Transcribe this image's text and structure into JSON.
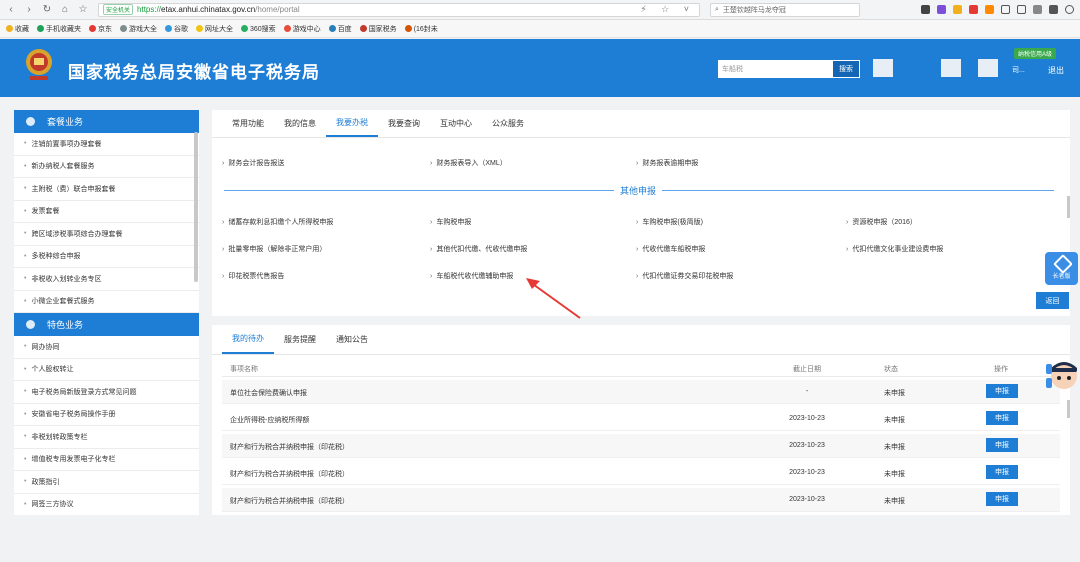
{
  "browser": {
    "safe_label": "安全机关",
    "url_scheme": "https://",
    "url_host": "etax.anhui.chinatax.gov.cn",
    "url_path": "/home/portal",
    "search_placeholder": "王楚钦越阵马龙夺冠",
    "bookmarks": [
      "收藏",
      "手机收藏夹",
      "京东",
      "游戏大全",
      "谷歌",
      "网址大全",
      "360搜索",
      "游戏中心",
      "百度",
      "国家税务",
      "(16封未"
    ]
  },
  "header": {
    "title": "国家税务总局安徽省电子税务局",
    "search_value": "车船税",
    "search_button": "搜索",
    "tag": "纳税信用A级",
    "user_text": "司...",
    "logout": "退出"
  },
  "sidebar": {
    "section1": "套餐业务",
    "items1": [
      "注销前置事项办理套餐",
      "新办纳税人套餐服务",
      "主附税（费）联合申报套餐",
      "发票套餐",
      "跨区域涉税事项综合办理套餐",
      "多税种综合申报",
      "非税收入划转业务专区",
      "小微企业套餐式服务"
    ],
    "section2": "特色业务",
    "items2": [
      "网办协同",
      "个人股权转让",
      "电子税务局新版登录方式常见问题",
      "安徽省电子税务局操作手册",
      "非税划转政策专栏",
      "增值税专用发票电子化专栏",
      "政策指引",
      "网签三方协议"
    ]
  },
  "main_tabs": [
    "常用功能",
    "我的信息",
    "我要办税",
    "我要查询",
    "互动中心",
    "公众服务"
  ],
  "links_top": [
    "财务会计报告报送",
    "财务报表导入（XML）",
    "财务报表逾期申报"
  ],
  "other_title": "其他申报",
  "links_other": [
    "储蓄存款利息扣缴个人所得税申报",
    "车购税申报",
    "车购税申报(极简版)",
    "资源税申报（2016）",
    "批量零申报（解除非正常户用）",
    "其他代扣代缴、代收代缴申报",
    "代收代缴车船税申报",
    "代扣代缴文化事业建设费申报",
    "印花税票代售报告",
    "车船税代收代缴辅助申报",
    "代扣代缴证券交易印花税申报"
  ],
  "return_button": "返回",
  "bottom_tabs": [
    "我的待办",
    "服务提醒",
    "通知公告"
  ],
  "table": {
    "headers": [
      "事项名称",
      "截止日期",
      "状态",
      "操作"
    ],
    "rows": [
      {
        "name": "单位社会保险费确认申报",
        "date": "-",
        "status": "未申报",
        "action": "申报"
      },
      {
        "name": "企业所得税-应纳税所得额",
        "date": "2023-10-23",
        "status": "未申报",
        "action": "申报"
      },
      {
        "name": "财产和行为税合并纳税申报（印花税）",
        "date": "2023-10-23",
        "status": "未申报",
        "action": "申报"
      },
      {
        "name": "财产和行为税合并纳税申报（印花税）",
        "date": "2023-10-23",
        "status": "未申报",
        "action": "申报"
      },
      {
        "name": "财产和行为税合并纳税申报（印花税）",
        "date": "2023-10-23",
        "status": "未申报",
        "action": "申报"
      }
    ]
  },
  "float": {
    "elder": "长者版"
  },
  "colors": {
    "brand": "#1e7dd4",
    "accent": "#1565b5",
    "arrow": "#e53935"
  }
}
